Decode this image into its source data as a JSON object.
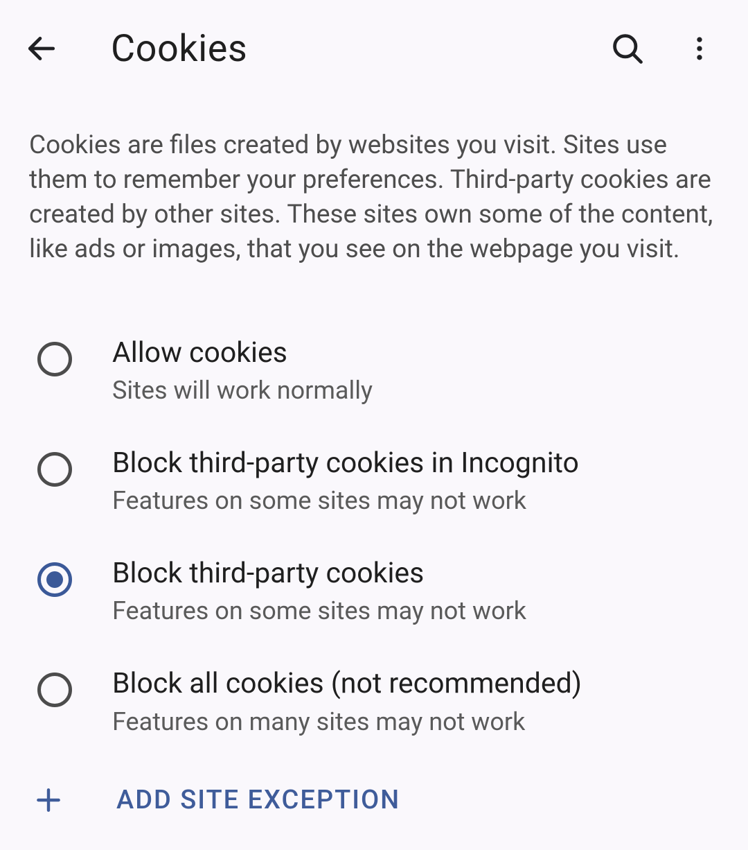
{
  "header": {
    "title": "Cookies"
  },
  "description": "Cookies are files created by websites you visit. Sites use them to remember your preferences. Third-party cookies are created by other sites. These sites own some of the content, like ads or images, that you see on the webpage you visit.",
  "options": [
    {
      "title": "Allow cookies",
      "subtitle": "Sites will work normally",
      "selected": false
    },
    {
      "title": "Block third-party cookies in Incognito",
      "subtitle": "Features on some sites may not work",
      "selected": false
    },
    {
      "title": "Block third-party cookies",
      "subtitle": "Features on some sites may not work",
      "selected": true
    },
    {
      "title": "Block all cookies (not recommended)",
      "subtitle": "Features on many sites may not work",
      "selected": false
    }
  ],
  "actions": {
    "add_exception_label": "ADD SITE EXCEPTION"
  }
}
